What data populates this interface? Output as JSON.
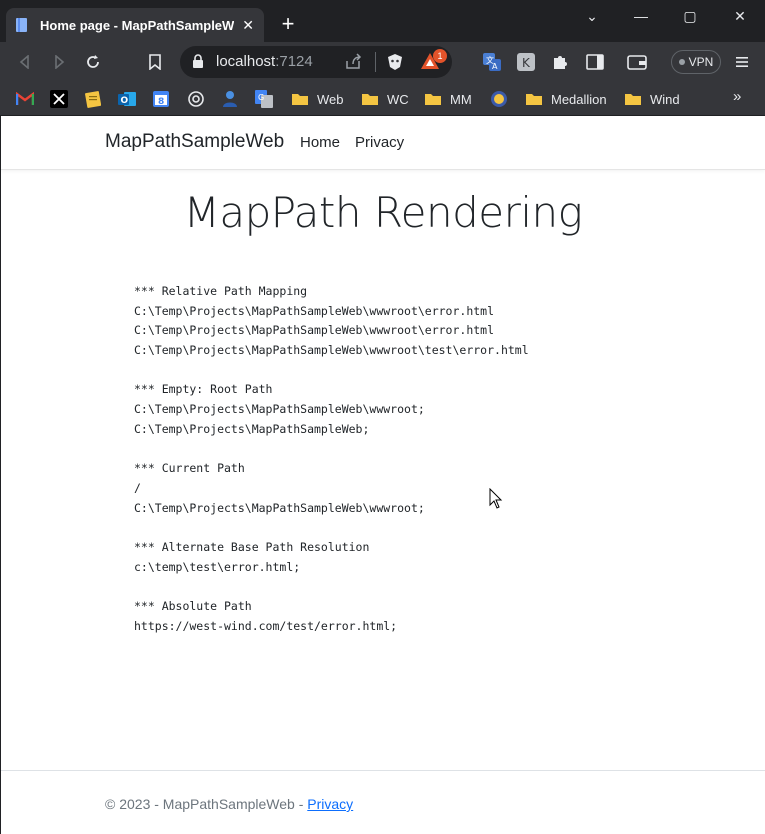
{
  "browser": {
    "tab_title": "Home page - MapPathSampleWeb",
    "url_host": "localhost",
    "url_port": ":7124",
    "shield_badge": "1",
    "vpn_label": "VPN",
    "bookmarks": [
      {
        "label": "Web"
      },
      {
        "label": "WC"
      },
      {
        "label": "MM"
      },
      {
        "label": "Medallion"
      },
      {
        "label": "Wind"
      }
    ],
    "bookmarks_overflow": "»"
  },
  "site": {
    "brand": "MapPathSampleWeb",
    "nav": [
      "Home",
      "Privacy"
    ]
  },
  "page": {
    "title": "MapPath Rendering",
    "output_lines": [
      "*** Relative Path Mapping",
      "C:\\Temp\\Projects\\MapPathSampleWeb\\wwwroot\\error.html",
      "C:\\Temp\\Projects\\MapPathSampleWeb\\wwwroot\\error.html",
      "C:\\Temp\\Projects\\MapPathSampleWeb\\wwwroot\\test\\error.html",
      "",
      "*** Empty: Root Path",
      "C:\\Temp\\Projects\\MapPathSampleWeb\\wwwroot;",
      "C:\\Temp\\Projects\\MapPathSampleWeb;",
      "",
      "*** Current Path",
      "/",
      "C:\\Temp\\Projects\\MapPathSampleWeb\\wwwroot;",
      "",
      "*** Alternate Base Path Resolution",
      "c:\\temp\\test\\error.html;",
      "",
      "*** Absolute Path",
      "https://west-wind.com/test/error.html;"
    ]
  },
  "footer": {
    "text": "© 2023 - MapPathSampleWeb - ",
    "link": "Privacy"
  },
  "colors": {
    "chrome_bg": "#202124",
    "toolbar_bg": "#35363a",
    "link": "#0d6efd"
  }
}
